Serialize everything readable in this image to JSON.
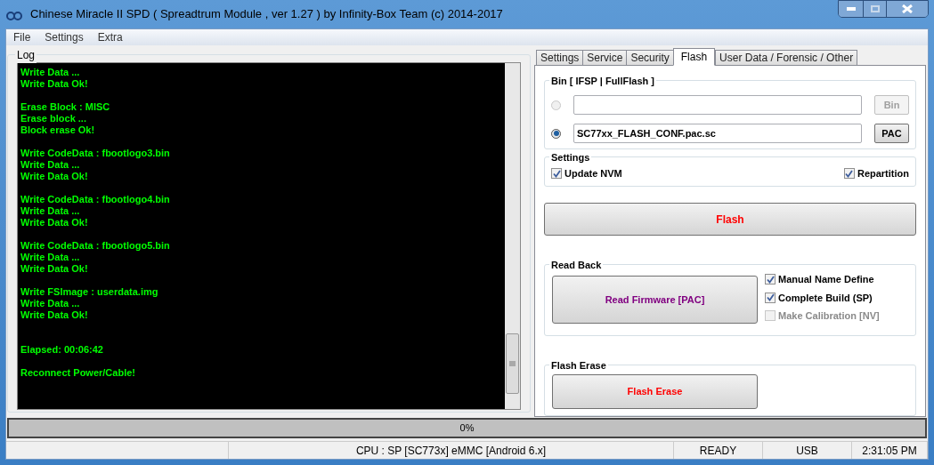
{
  "window": {
    "title": "Chinese Miracle II SPD ( Spreadtrum Module , ver 1.27 ) by Infinity-Box Team (c) 2014-2017"
  },
  "menu": [
    "File",
    "Settings",
    "Extra"
  ],
  "log": {
    "title": "Log",
    "blocks": [
      {
        "kind": "top",
        "lines": [
          "Write Data ...",
          "Write Data Ok!"
        ]
      },
      {
        "kind": "normal",
        "lines": [
          "Erase Block : MISC",
          "Erase block ...",
          "Block erase Ok!"
        ]
      },
      {
        "kind": "normal",
        "lines": [
          "Write CodeData : fbootlogo3.bin",
          "Write Data ...",
          "Write Data Ok!"
        ]
      },
      {
        "kind": "normal",
        "lines": [
          "Write CodeData : fbootlogo4.bin",
          "Write Data ...",
          "Write Data Ok!"
        ]
      },
      {
        "kind": "normal",
        "lines": [
          "Write CodeData : fbootlogo5.bin",
          "Write Data ...",
          "Write Data Ok!"
        ]
      },
      {
        "kind": "normal",
        "lines": [
          "Write FSImage : userdata.img",
          "Write Data ...",
          "Write Data Ok!"
        ]
      },
      {
        "kind": "wide",
        "lines": [
          "Elapsed: 00:06:42"
        ]
      },
      {
        "kind": "normal",
        "lines": [
          "Reconnect Power/Cable!"
        ]
      }
    ]
  },
  "tabs": [
    {
      "label": "Settings",
      "selected": false
    },
    {
      "label": "Service",
      "selected": false
    },
    {
      "label": "Security",
      "selected": false
    },
    {
      "label": "Flash",
      "selected": true
    },
    {
      "label": "User Data / Forensic / Other",
      "selected": false
    }
  ],
  "bin_group": {
    "title": "Bin  [ IFSP | FullFlash ]",
    "rows": [
      {
        "selected": false,
        "disabled": true,
        "button": "Bin"
      },
      {
        "selected": true,
        "disabled": false,
        "value": "SC77xx_FLASH_CONF.pac.sc",
        "button": "PAC"
      }
    ]
  },
  "settings_group": {
    "title": "Settings",
    "options": [
      {
        "label": "Update NVM",
        "checked": true
      },
      {
        "label": "Repartition",
        "checked": true
      }
    ]
  },
  "flash_button": "Flash",
  "read_back": {
    "title": "Read Back",
    "button": "Read Firmware [PAC]",
    "options": [
      {
        "label": "Manual Name Define",
        "checked": true,
        "disabled": false
      },
      {
        "label": "Complete Build (SP)",
        "checked": true,
        "disabled": false
      },
      {
        "label": "Make Calibration [NV]",
        "checked": false,
        "disabled": true
      }
    ]
  },
  "flash_erase": {
    "title": "Flash Erase",
    "button": "Flash Erase"
  },
  "progress": {
    "label": "0%",
    "level": 0
  },
  "status_bar": [
    "CPU : SP [SC773x] eMMC [Android 6.x]",
    "READY",
    "USB",
    "2:31:05 PM"
  ]
}
